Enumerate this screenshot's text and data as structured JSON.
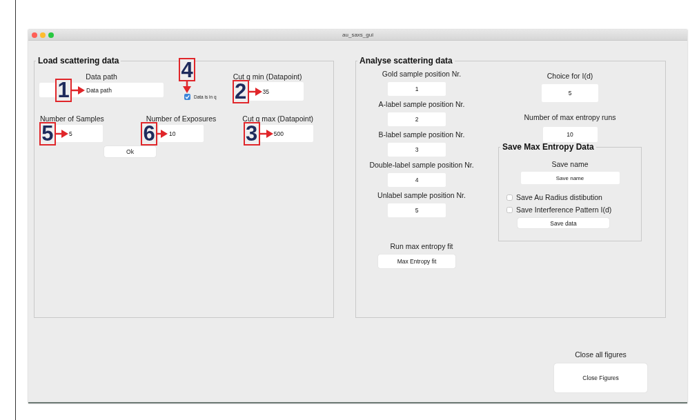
{
  "window": {
    "title": "au_saxs_gui"
  },
  "load_panel": {
    "title": "Load scattering data",
    "data_path": {
      "label": "Data path",
      "value": "Data path",
      "marker": "1"
    },
    "data_in_q": {
      "label": "Data is in q",
      "checked": true,
      "marker": "4"
    },
    "cut_q_min": {
      "label": "Cut q min (Datapoint)",
      "value": "35",
      "marker": "2"
    },
    "samples": {
      "label": "Number of Samples",
      "value": "5",
      "marker": "5"
    },
    "exposures": {
      "label": "Number of Exposures",
      "value": "10",
      "marker": "6"
    },
    "cut_q_max": {
      "label": "Cut q max (Datapoint)",
      "value": "500",
      "marker": "3"
    },
    "ok_button": "Ok"
  },
  "analyse_panel": {
    "title": "Analyse scattering data",
    "positions": [
      {
        "label": "Gold sample position Nr.",
        "value": "1"
      },
      {
        "label": "A-label sample position Nr.",
        "value": "2"
      },
      {
        "label": "B-label sample position Nr.",
        "value": "3"
      },
      {
        "label": "Double-label sample position Nr.",
        "value": "4"
      },
      {
        "label": "Unlabel sample position Nr.",
        "value": "5"
      }
    ],
    "choice": {
      "label": "Choice for I(d)",
      "value": "5"
    },
    "runs": {
      "label": "Number of max entropy runs",
      "value": "10"
    },
    "run_fit": {
      "label": "Run max entropy fit",
      "button": "Max Entropy fit"
    },
    "save_panel": {
      "title": "Save Max Entropy Data",
      "name_label": "Save name",
      "name_value": "Save name",
      "options": [
        {
          "label": "Save Au Radius distibution",
          "checked": false
        },
        {
          "label": "Save Interference Pattern I(d)",
          "checked": false
        }
      ],
      "button": "Save data"
    }
  },
  "close": {
    "label": "Close all figures",
    "button": "Close Figures"
  }
}
